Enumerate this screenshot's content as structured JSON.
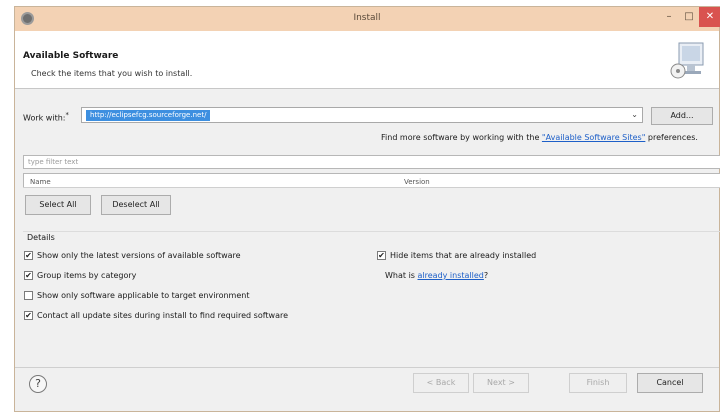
{
  "window": {
    "title": "Install"
  },
  "header": {
    "title": "Available Software",
    "subtitle": "Check the items that you wish to install."
  },
  "work_with": {
    "label": "Work with:",
    "required_marker": "*",
    "value": "http://eclipsefcg.sourceforge.net/",
    "add_button": "Add...",
    "hint_prefix": "Find more software by working with the",
    "hint_link": "\"Available Software Sites\"",
    "hint_suffix": "preferences."
  },
  "filter": {
    "placeholder": "type filter text"
  },
  "tree": {
    "columns": [
      "Name",
      "Version"
    ]
  },
  "actions": {
    "select_all": "Select All",
    "deselect_all": "Deselect All"
  },
  "details": {
    "label": "Details",
    "options": [
      {
        "label": "Show only the latest versions of available software",
        "checked": true
      },
      {
        "label": "Group items by category",
        "checked": true
      },
      {
        "label": "Show only software applicable to target environment",
        "checked": false
      },
      {
        "label": "Contact all update sites during install to find required software",
        "checked": true
      }
    ],
    "hide_installed": {
      "label": "Hide items that are already installed",
      "checked": true
    },
    "what_is_prefix": "What is",
    "what_is_link": "already installed",
    "what_is_suffix": "?"
  },
  "footer": {
    "help": "?",
    "back": "< Back",
    "next": "Next >",
    "finish": "Finish",
    "cancel": "Cancel"
  },
  "colors": {
    "title_bar": "#f3d2b4",
    "selection": "#3d8fe0",
    "link": "#1d5fc8",
    "close_button": "#d9534f"
  }
}
